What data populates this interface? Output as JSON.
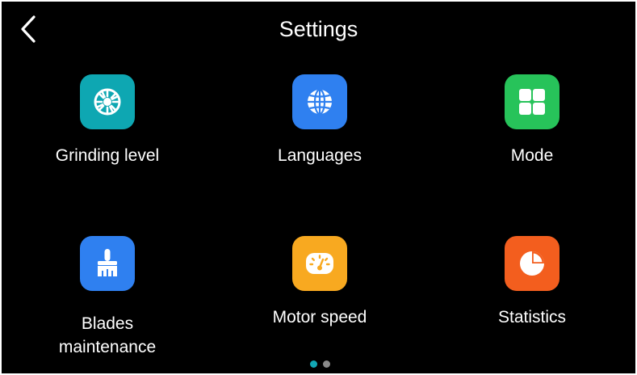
{
  "header": {
    "title": "Settings",
    "back_icon": "chevron-left-icon"
  },
  "tiles": [
    {
      "label": "Grinding level",
      "icon": "grinding-blade-icon",
      "color": "#0EA7B2"
    },
    {
      "label": "Languages",
      "icon": "globe-icon",
      "color": "#2F80F0"
    },
    {
      "label": "Mode",
      "icon": "grid-icon",
      "color": "#27C35A"
    },
    {
      "label": "Blades\nmaintenance",
      "icon": "brush-icon",
      "color": "#2F80F0"
    },
    {
      "label": "Motor speed",
      "icon": "speedometer-icon",
      "color": "#F8A920"
    },
    {
      "label": "Statistics",
      "icon": "pie-chart-icon",
      "color": "#F35E1E"
    }
  ],
  "pagination": {
    "pages": 2,
    "current": 1,
    "active_color": "#12A7B5",
    "inactive_color": "#8A8A8A"
  }
}
